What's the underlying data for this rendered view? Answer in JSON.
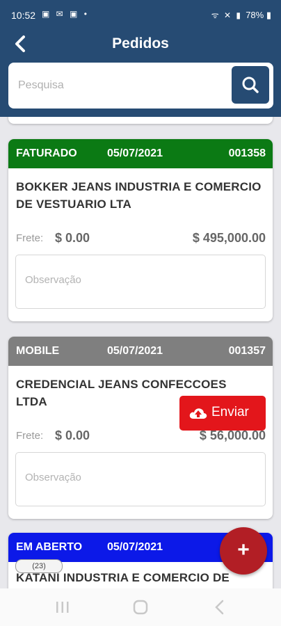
{
  "status_bar": {
    "time": "10:52",
    "battery": "78%"
  },
  "header": {
    "title": "Pedidos"
  },
  "search": {
    "placeholder": "Pesquisa"
  },
  "orders": [
    {
      "status": "FATURADO",
      "status_color": "#0b7a14",
      "date": "05/07/2021",
      "number": "001358",
      "client": "BOKKER JEANS INDUSTRIA E COMERCIO DE VESTUARIO LTA",
      "frete_label": "Frete:",
      "frete": "$ 0.00",
      "total": "$ 495,000.00",
      "obs_placeholder": "Observação"
    },
    {
      "status": "MOBILE",
      "status_color": "#7f7f7f",
      "date": "05/07/2021",
      "number": "001357",
      "client": "CREDENCIAL JEANS CONFECCOES LTDA",
      "frete_label": "Frete:",
      "frete": "$ 0.00",
      "total": "$ 56,000.00",
      "obs_placeholder": "Observação",
      "send_button": "Enviar"
    },
    {
      "status": "EM ABERTO",
      "status_color": "#0c19e8",
      "date": "05/07/2021",
      "client": "KATANI INDUSTRIA E COMERCIO DE"
    }
  ],
  "list_badge": "(23)",
  "fab": {
    "icon": "plus-icon",
    "symbol": "+"
  },
  "colors": {
    "primary": "#264b73",
    "send": "#e3161b",
    "fab": "#b21e25"
  }
}
